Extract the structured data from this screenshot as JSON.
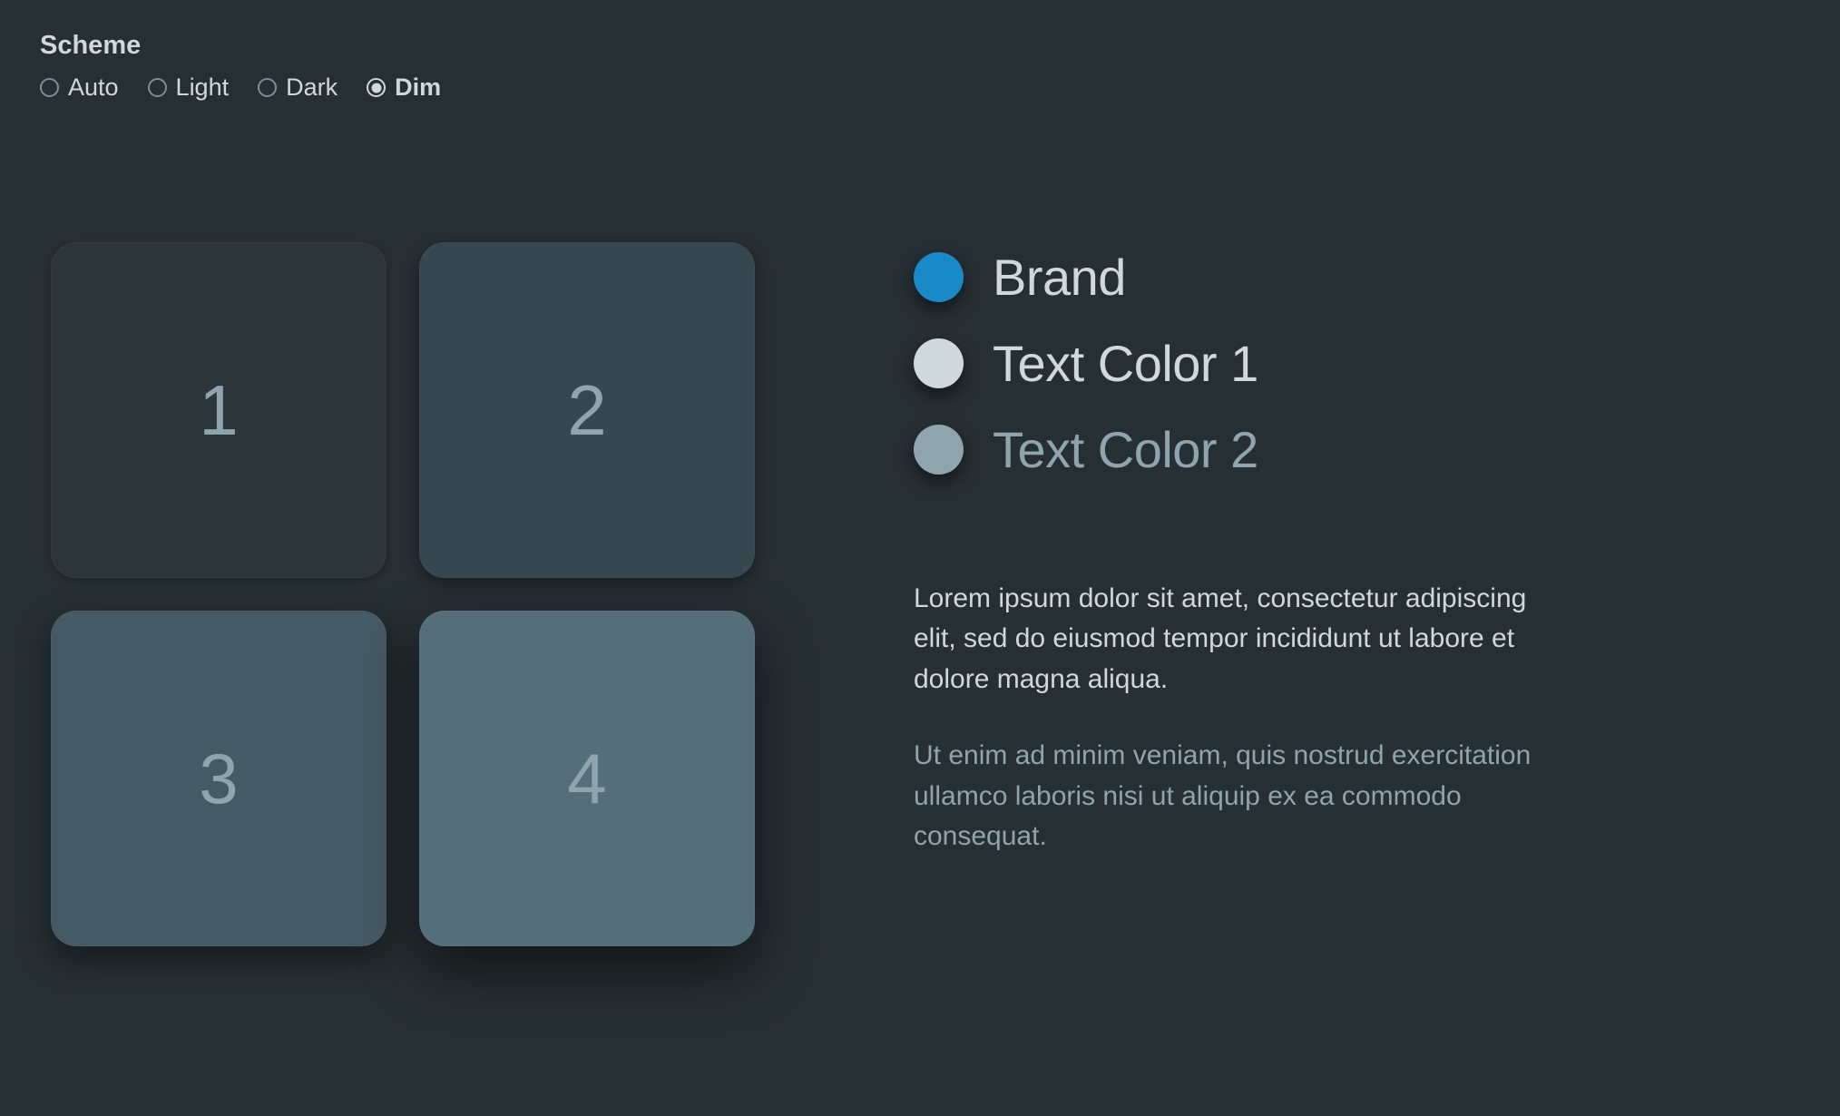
{
  "scheme": {
    "heading": "Scheme",
    "options": [
      {
        "id": "auto",
        "label": "Auto",
        "selected": false
      },
      {
        "id": "light",
        "label": "Light",
        "selected": false
      },
      {
        "id": "dark",
        "label": "Dark",
        "selected": false
      },
      {
        "id": "dim",
        "label": "Dim",
        "selected": true
      }
    ]
  },
  "elevation": {
    "cards": [
      "1",
      "2",
      "3",
      "4"
    ]
  },
  "swatches": [
    {
      "id": "brand",
      "label": "Brand",
      "color": "#1989c8",
      "label_color": "#cfd8dc"
    },
    {
      "id": "text-color-1",
      "label": "Text Color 1",
      "color": "#cfd8dc",
      "label_color": "#cfd8dc"
    },
    {
      "id": "text-color-2",
      "label": "Text Color 2",
      "color": "#90a4ae",
      "label_color": "#90a4ae"
    }
  ],
  "paragraphs": [
    {
      "text": "Lorem ipsum dolor sit amet, consectetur adipiscing elit, sed do eiusmod tempor incididunt ut labore et dolore magna aliqua.",
      "color": "#cfd8dc"
    },
    {
      "text": "Ut enim ad minim veniam, quis nostrud exercitation ullamco laboris nisi ut aliquip ex ea commodo consequat.",
      "color": "#90a4ae"
    }
  ],
  "colors": {
    "background": "#262f33",
    "brand": "#1989c8",
    "text1": "#cfd8dc",
    "text2": "#90a4ae"
  }
}
